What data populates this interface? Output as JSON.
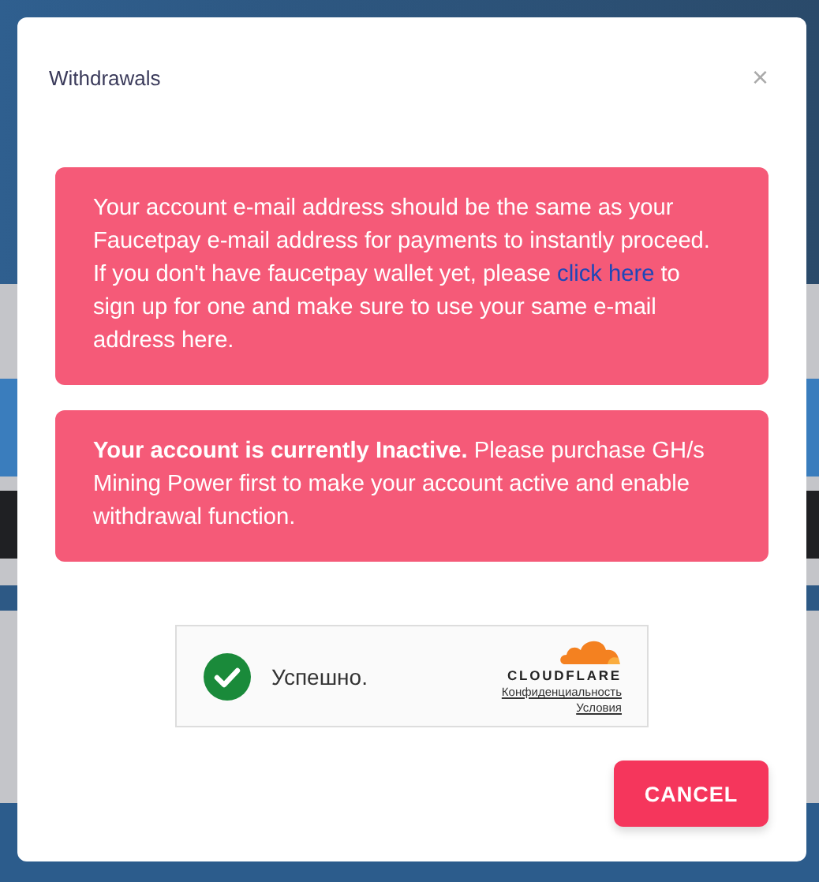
{
  "modal": {
    "title": "Withdrawals",
    "close": "×"
  },
  "alerts": [
    {
      "text": "Your account e-mail address should be the same as your Faucetpay e-mail address for payments to instantly proceed. If you don't have faucetpay wallet yet, please ",
      "link": "click here",
      "text_after": " to sign up for one and make sure to use your same e-mail address here."
    },
    {
      "text": "**Your account is currently Inactive.** Please purchase GH/s Mining Power first to make your account active and enable withdrawal function."
    }
  ],
  "captcha": {
    "success": true,
    "status": "Успешно.",
    "brand": "CLOUDFLARE",
    "links": [
      "Конфиденциальность",
      "Условия"
    ]
  },
  "buttons": [
    {
      "label": "CANCEL"
    }
  ]
}
